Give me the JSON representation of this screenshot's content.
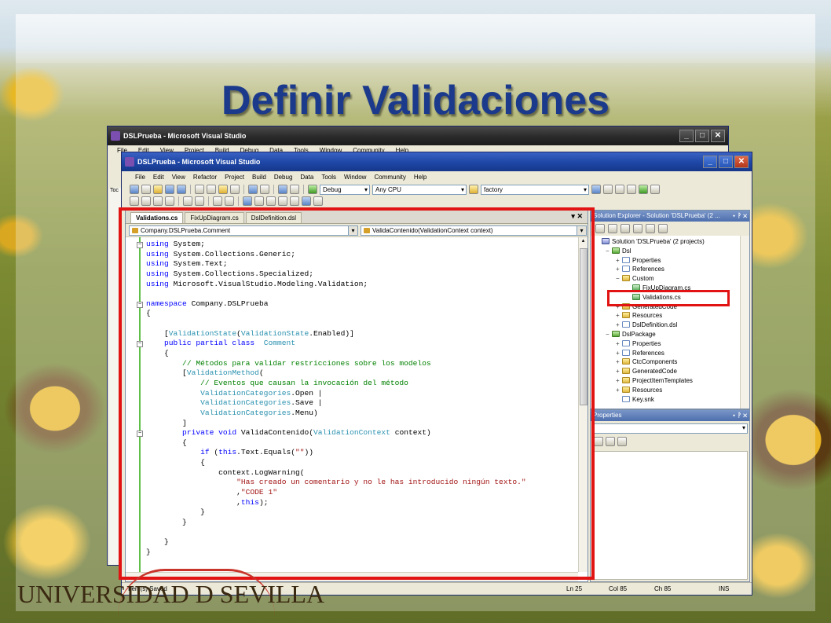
{
  "slide": {
    "title": "Definir Validaciones",
    "brand": "UNIVERSIDAD D SEVILLA"
  },
  "back_window": {
    "title": "DSLPrueba - Microsoft Visual Studio",
    "menu": [
      "File",
      "Edit",
      "View",
      "Project",
      "Build",
      "Debug",
      "Data",
      "Tools",
      "Window",
      "Community",
      "Help"
    ],
    "side_label": "Toc"
  },
  "window": {
    "title": "DSLPrueba - Microsoft Visual Studio",
    "menu": [
      "File",
      "Edit",
      "View",
      "Refactor",
      "Project",
      "Build",
      "Debug",
      "Data",
      "Tools",
      "Window",
      "Community",
      "Help"
    ],
    "toolbar": {
      "config": "Debug",
      "platform": "Any CPU",
      "find": "factory"
    }
  },
  "editor": {
    "tabs": [
      "Validations.cs",
      "FixUpDiagram.cs",
      "DslDefinition.dsl"
    ],
    "type_combo": "Company.DSLPrueba.Comment",
    "member_combo": "ValidaContenido(ValidationContext context)",
    "code_lines": [
      [
        [
          "kw",
          "using"
        ],
        [
          "",
          "System;"
        ]
      ],
      [
        [
          "kw",
          "using"
        ],
        [
          "",
          "System.Collections.Generic;"
        ]
      ],
      [
        [
          "kw",
          "using"
        ],
        [
          "",
          "System.Text;"
        ]
      ],
      [
        [
          "kw",
          "using"
        ],
        [
          "",
          "System.Collections.Specialized;"
        ]
      ],
      [
        [
          "kw",
          "using"
        ],
        [
          "",
          "Microsoft.VisualStudio.Modeling.Validation;"
        ]
      ],
      [],
      [
        [
          "kw",
          "namespace"
        ],
        [
          "",
          "Company.DSLPrueba"
        ]
      ],
      [
        [
          "",
          "{"
        ]
      ],
      [],
      [
        [
          "",
          "    ["
        ],
        [
          "ty",
          "ValidationState"
        ],
        [
          "",
          "("
        ],
        [
          "ty",
          "ValidationState"
        ],
        [
          "",
          ".Enabled)]"
        ]
      ],
      [
        [
          "kw",
          "    public partial class"
        ],
        [
          "",
          ""
        ],
        [
          "ty",
          "Comment"
        ]
      ],
      [
        [
          "",
          "    {"
        ]
      ],
      [
        [
          "cm",
          "        // Métodos para validar restricciones sobre los modelos"
        ]
      ],
      [
        [
          "",
          "        ["
        ],
        [
          "ty",
          "ValidationMethod"
        ],
        [
          "",
          "("
        ]
      ],
      [
        [
          "cm",
          "            // Eventos que causan la invocación del método"
        ]
      ],
      [
        [
          "ty",
          "            ValidationCategories"
        ],
        [
          "",
          ".Open |"
        ]
      ],
      [
        [
          "ty",
          "            ValidationCategories"
        ],
        [
          "",
          ".Save |"
        ]
      ],
      [
        [
          "ty",
          "            ValidationCategories"
        ],
        [
          "",
          ".Menu)"
        ]
      ],
      [
        [
          "",
          "        ]"
        ]
      ],
      [
        [
          "kw",
          "        private void"
        ],
        [
          "",
          "ValidaContenido("
        ],
        [
          "ty",
          "ValidationContext"
        ],
        [
          "",
          "context)"
        ]
      ],
      [
        [
          "",
          "        {"
        ]
      ],
      [
        [
          "kw",
          "            if"
        ],
        [
          "",
          "("
        ],
        [
          "kw",
          "this"
        ],
        [
          "",
          ".Text.Equals("
        ],
        [
          "st",
          "\"\""
        ],
        [
          "",
          "))"
        ]
      ],
      [
        [
          "",
          "            {"
        ]
      ],
      [
        [
          "",
          "                context.LogWarning("
        ]
      ],
      [
        [
          "st",
          "                    \"Has creado un comentario y no le has introducido ningún texto.\""
        ]
      ],
      [
        [
          "",
          "                    ,"
        ],
        [
          "st",
          "\"CODE 1\""
        ]
      ],
      [
        [
          "",
          "                    ,"
        ],
        [
          "kw",
          "this"
        ],
        [
          "",
          ");"
        ]
      ],
      [
        [
          "",
          "            }"
        ]
      ],
      [
        [
          "",
          "        }"
        ]
      ],
      [],
      [
        [
          "",
          "    }"
        ]
      ],
      [
        [
          "",
          "}"
        ]
      ]
    ]
  },
  "solution_explorer": {
    "title": "Solution Explorer - Solution 'DSLPrueba' (2 ...",
    "items": [
      {
        "indent": 0,
        "exp": "",
        "icon": "sol",
        "label": "Solution 'DSLPrueba' (2 projects)"
      },
      {
        "indent": 1,
        "exp": "−",
        "icon": "proj",
        "label": "Dsl"
      },
      {
        "indent": 2,
        "exp": "+",
        "icon": "file",
        "label": "Properties"
      },
      {
        "indent": 2,
        "exp": "+",
        "icon": "file",
        "label": "References"
      },
      {
        "indent": 2,
        "exp": "−",
        "icon": "folder",
        "label": "Custom"
      },
      {
        "indent": 3,
        "exp": "",
        "icon": "cs",
        "label": "FixUpDiagram.cs"
      },
      {
        "indent": 3,
        "exp": "",
        "icon": "cs",
        "label": "Validations.cs"
      },
      {
        "indent": 2,
        "exp": "+",
        "icon": "folder",
        "label": "GeneratedCode"
      },
      {
        "indent": 2,
        "exp": "+",
        "icon": "folder",
        "label": "Resources"
      },
      {
        "indent": 2,
        "exp": "+",
        "icon": "file",
        "label": "DslDefinition.dsl"
      },
      {
        "indent": 1,
        "exp": "−",
        "icon": "proj",
        "label": "DslPackage"
      },
      {
        "indent": 2,
        "exp": "+",
        "icon": "file",
        "label": "Properties"
      },
      {
        "indent": 2,
        "exp": "+",
        "icon": "file",
        "label": "References"
      },
      {
        "indent": 2,
        "exp": "+",
        "icon": "folder",
        "label": "CtcComponents"
      },
      {
        "indent": 2,
        "exp": "+",
        "icon": "folder",
        "label": "GeneratedCode"
      },
      {
        "indent": 2,
        "exp": "+",
        "icon": "folder",
        "label": "ProjectItemTemplates"
      },
      {
        "indent": 2,
        "exp": "+",
        "icon": "folder",
        "label": "Resources"
      },
      {
        "indent": 2,
        "exp": "",
        "icon": "file",
        "label": "Key.snk"
      }
    ]
  },
  "properties": {
    "title": "Properties"
  },
  "status": {
    "message": "Item(s) Saved",
    "ln": "Ln 25",
    "col": "Col 85",
    "ch": "Ch 85",
    "mode": "INS"
  },
  "colors": {
    "highlight": "#e11313",
    "title": "#1c3a8c"
  }
}
